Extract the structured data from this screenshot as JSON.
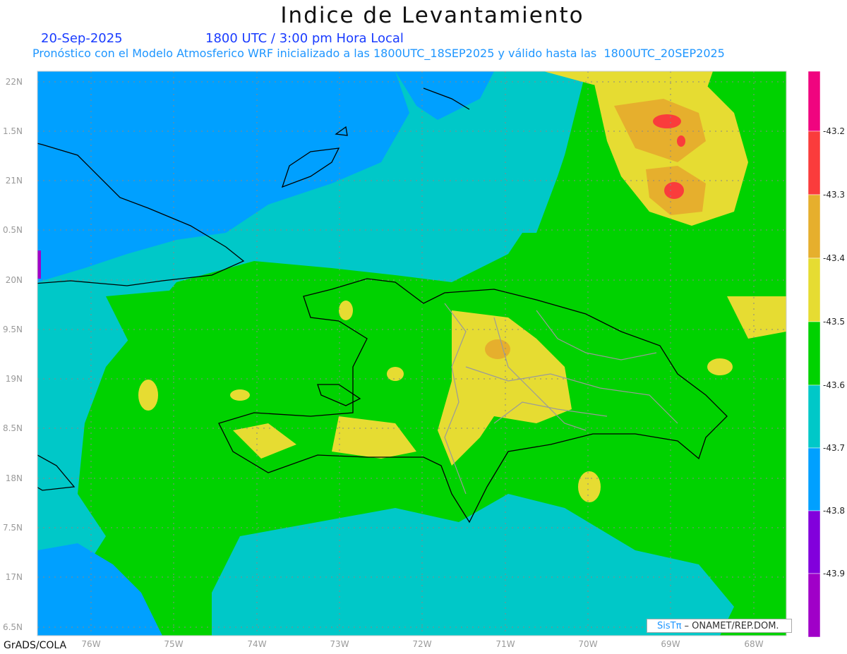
{
  "header": {
    "title": "Indice de Levantamiento",
    "date": "20-Sep-2025",
    "time": "1800 UTC / 3:00 pm Hora Local",
    "description": "Pronóstico con el Modelo Atmosferico WRF inicializado a las 1800UTC_18SEP2025 y válido hasta las  1800UTC_20SEP2025"
  },
  "axes": {
    "lat_labels": [
      "22N",
      "1.5N",
      "21N",
      "0.5N",
      "20N",
      "9.5N",
      "19N",
      "8.5N",
      "18N",
      "7.5N",
      "17N",
      "6.5N"
    ],
    "lon_labels": [
      "76W",
      "75W",
      "74W",
      "73W",
      "72W",
      "71W",
      "70W",
      "69W",
      "68W"
    ]
  },
  "colorbar": {
    "labels": [
      "-43.2",
      "-43.3",
      "-43.4",
      "-43.5",
      "-43.6",
      "-43.7",
      "-43.8",
      "-43.9"
    ],
    "colors": [
      "#f0047f",
      "#fa3c3c",
      "#e6af2d",
      "#e6dc32",
      "#00d200",
      "#00c8c8",
      "#00a0ff",
      "#8200dc",
      "#a000c8"
    ]
  },
  "credit": {
    "brand": "SisTπ",
    "text": " – ONAMET/REP.DOM."
  },
  "footer": "GrADS/COLA"
}
